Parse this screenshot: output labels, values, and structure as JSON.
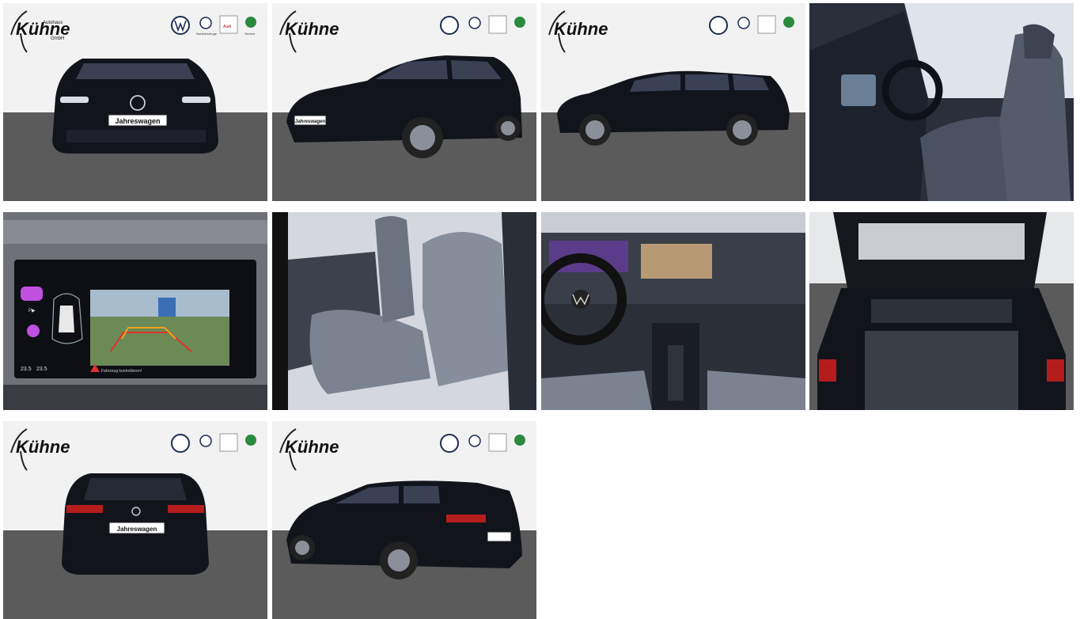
{
  "dealer": {
    "name": "Kühne",
    "prefix": "Autohaus",
    "suffix": "GmbH",
    "brand_tagline": "Nutzfahrzeuge",
    "audi_line1": "Audi",
    "audi_line2": "Service",
    "skoda_line": "Service"
  },
  "gallery": {
    "plate_text": "Jahreswagen",
    "camera_warning": "Fahrzeug kontrollieren!",
    "camera_icon_p": "P▶",
    "temp_left": "23.5",
    "temp_right": "23.5",
    "images": [
      {
        "alt": "front view"
      },
      {
        "alt": "front three-quarter view"
      },
      {
        "alt": "side view"
      },
      {
        "alt": "interior front seats"
      },
      {
        "alt": "rear view camera display"
      },
      {
        "alt": "rear seats"
      },
      {
        "alt": "cockpit and center console"
      },
      {
        "alt": "open trunk"
      },
      {
        "alt": "rear view"
      },
      {
        "alt": "rear three-quarter view"
      }
    ]
  },
  "colors": {
    "car": "#12141c",
    "floor": "#5b5b5b",
    "wall": "#f2f2f2"
  }
}
